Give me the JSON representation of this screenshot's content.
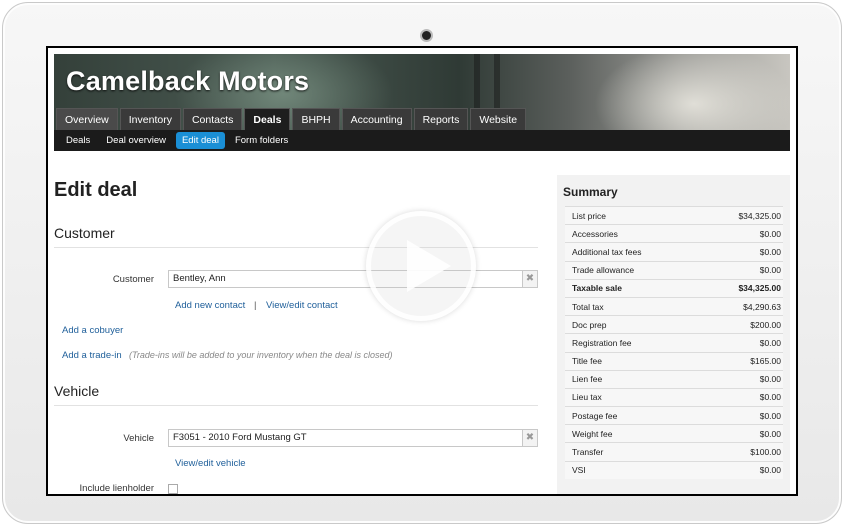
{
  "app": {
    "brand": "Camelback Motors"
  },
  "tabs": [
    "Overview",
    "Inventory",
    "Contacts",
    "Deals",
    "BHPH",
    "Accounting",
    "Reports",
    "Website"
  ],
  "subnav": [
    "Deals",
    "Deal overview",
    "Edit deal",
    "Form folders"
  ],
  "page": {
    "title": "Edit deal"
  },
  "customer": {
    "section": "Customer",
    "label": "Customer",
    "value": "Bentley, Ann",
    "add_new_contact": "Add new contact",
    "separator": "|",
    "view_edit_contact": "View/edit contact",
    "add_cobuyer": "Add a cobuyer",
    "add_tradein": "Add a trade-in",
    "tradein_note": "(Trade-ins will be added to your inventory when the deal is closed)"
  },
  "vehicle": {
    "section": "Vehicle",
    "label": "Vehicle",
    "value": "F3051 - 2010 Ford Mustang GT",
    "view_edit_vehicle": "View/edit vehicle",
    "include_lienholder": "Include lienholder"
  },
  "clear_glyph": "✖",
  "summary": {
    "title": "Summary",
    "rows": [
      {
        "label": "List price",
        "value": "$34,325.00"
      },
      {
        "label": "Accessories",
        "value": "$0.00"
      },
      {
        "label": "Additional tax fees",
        "value": "$0.00"
      },
      {
        "label": "Trade allowance",
        "value": "$0.00"
      },
      {
        "label": "Taxable sale",
        "value": "$34,325.00",
        "bold": true
      },
      {
        "label": "Total tax",
        "value": "$4,290.63"
      },
      {
        "label": "Doc prep",
        "value": "$200.00"
      },
      {
        "label": "Registration fee",
        "value": "$0.00"
      },
      {
        "label": "Title fee",
        "value": "$165.00"
      },
      {
        "label": "Lien fee",
        "value": "$0.00"
      },
      {
        "label": "Lieu tax",
        "value": "$0.00"
      },
      {
        "label": "Postage fee",
        "value": "$0.00"
      },
      {
        "label": "Weight fee",
        "value": "$0.00"
      },
      {
        "label": "Transfer",
        "value": "$100.00"
      },
      {
        "label": "VSI",
        "value": "$0.00"
      }
    ]
  },
  "colors": {
    "accent": "#1a8fd6",
    "link": "#1f5f9a",
    "nav": "#1b1b1b"
  },
  "icons": {
    "play": "play-icon",
    "camera": "camera-icon"
  }
}
